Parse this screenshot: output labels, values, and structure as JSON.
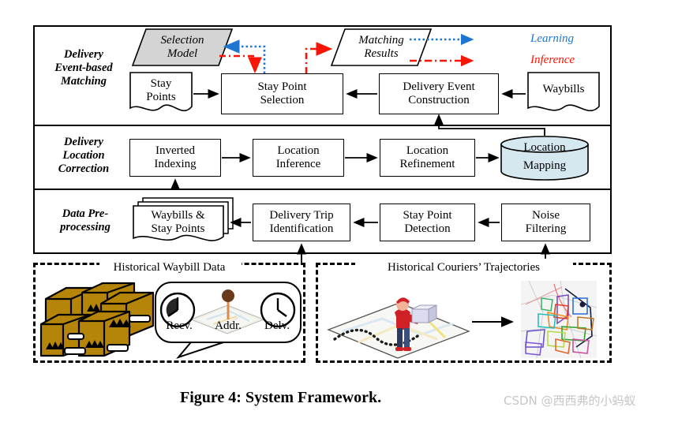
{
  "figure": {
    "caption": "Figure 4: System Framework.",
    "watermark": "CSDN @西西弗的小蚂蚁"
  },
  "colors": {
    "learning": "#1f76d2",
    "inference": "#fa1405",
    "selection_model_fill": "#d4d4d4",
    "database_fill": "#d6e8ef",
    "box_brown": "#b5850a",
    "stroke": "#000000",
    "watermark": "#c6c6c6"
  },
  "legend": {
    "items": [
      {
        "label": "Learning",
        "style": "dotted-arrow",
        "color": "#1f76d2"
      },
      {
        "label": "Inference",
        "style": "dashdot-arrow",
        "color": "#fa1405"
      }
    ]
  },
  "bands": [
    {
      "id": "delivery-event-based-matching",
      "title": "Delivery\nEvent-based\nMatching",
      "title_lines": [
        "Delivery",
        "Event-based",
        "Matching"
      ],
      "nodes": [
        {
          "id": "selection-model",
          "label": "Selection\nModel",
          "label_lines": [
            "Selection",
            "Model"
          ],
          "shape": "parallelogram",
          "fill": "#d4d4d4"
        },
        {
          "id": "matching-results",
          "label": "Matching\nResults",
          "label_lines": [
            "Matching",
            "Results"
          ],
          "shape": "parallelogram",
          "fill": "#ffffff"
        },
        {
          "id": "stay-points",
          "label": "Stay\nPoints",
          "label_lines": [
            "Stay",
            "Points"
          ],
          "shape": "document"
        },
        {
          "id": "stay-point-selection",
          "label": "Stay Point\nSelection",
          "label_lines": [
            "Stay Point",
            "Selection"
          ],
          "shape": "rect"
        },
        {
          "id": "delivery-event-construction",
          "label": "Delivery Event\nConstruction",
          "label_lines": [
            "Delivery Event",
            "Construction"
          ],
          "shape": "rect"
        },
        {
          "id": "waybills",
          "label": "Waybills",
          "label_lines": [
            "Waybills"
          ],
          "shape": "document"
        }
      ]
    },
    {
      "id": "delivery-location-correction",
      "title": "Delivery\nLocation\nCorrection",
      "title_lines": [
        "Delivery",
        "Location",
        "Correction"
      ],
      "nodes": [
        {
          "id": "inverted-indexing",
          "label": "Inverted\nIndexing",
          "label_lines": [
            "Inverted",
            "Indexing"
          ],
          "shape": "rect"
        },
        {
          "id": "location-inference",
          "label": "Location\nInference",
          "label_lines": [
            "Location",
            "Inference"
          ],
          "shape": "rect"
        },
        {
          "id": "location-refinement",
          "label": "Location\nRefinement",
          "label_lines": [
            "Location",
            "Refinement"
          ],
          "shape": "rect"
        },
        {
          "id": "location-mapping",
          "label": "Location\nMapping",
          "label_lines": [
            "Location",
            "Mapping"
          ],
          "shape": "cylinder",
          "fill": "#d6e8ef"
        }
      ]
    },
    {
      "id": "data-pre-processing",
      "title": "Data Pre-\nprocessing",
      "title_lines": [
        "Data Pre-",
        "processing"
      ],
      "nodes": [
        {
          "id": "waybills-and-stay-points",
          "label": "Waybills &\nStay Points",
          "label_lines": [
            "Waybills &",
            "Stay Points"
          ],
          "shape": "stacked-document"
        },
        {
          "id": "delivery-trip-identification",
          "label": "Delivery Trip\nIdentification",
          "label_lines": [
            "Delivery Trip",
            "Identification"
          ],
          "shape": "rect"
        },
        {
          "id": "stay-point-detection",
          "label": "Stay Point\nDetection",
          "label_lines": [
            "Stay Point",
            "Detection"
          ],
          "shape": "rect"
        },
        {
          "id": "noise-filtering",
          "label": "Noise\nFiltering",
          "label_lines": [
            "Noise",
            "Filtering"
          ],
          "shape": "rect"
        }
      ]
    }
  ],
  "data_sources": [
    {
      "id": "historical-waybill-data",
      "title": "Historical Waybill Data",
      "callout_labels": [
        "Recv.",
        "Addr.",
        "Delv."
      ],
      "icons": [
        "parcel-boxes-icon",
        "clock-icon",
        "map-pin-icon",
        "clock-icon"
      ]
    },
    {
      "id": "historical-couriers-trajectories",
      "title": "Historical Couriers’ Trajectories",
      "icons": [
        "courier-on-map-icon",
        "arrow-right-icon",
        "trajectory-map-icon"
      ]
    }
  ]
}
